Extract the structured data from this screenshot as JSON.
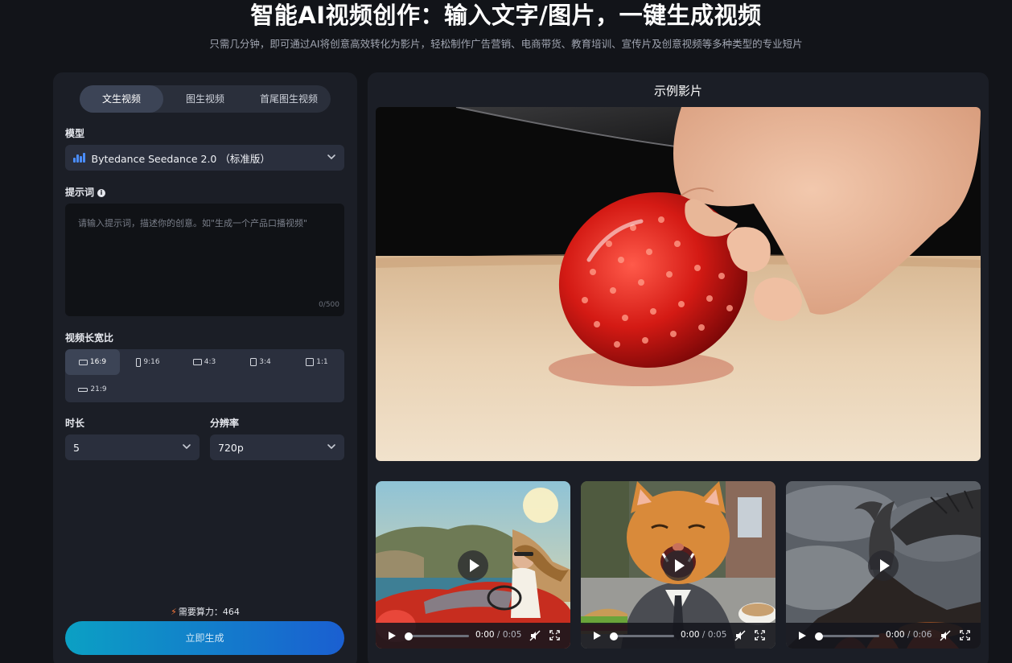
{
  "header": {
    "title": "智能AI视频创作：输入文字/图片，一键生成视频",
    "subtitle": "只需几分钟，即可通过AI将创意高效转化为影片，轻松制作广告营销、电商带货、教育培训、宣传片及创意视频等多种类型的专业短片"
  },
  "mode_tabs": [
    {
      "label": "文生视频",
      "active": true
    },
    {
      "label": "图生视频",
      "active": false
    },
    {
      "label": "首尾图生视频",
      "active": false
    }
  ],
  "model": {
    "label": "模型",
    "selected": "Bytedance Seedance 2.0 （标准版）",
    "icon": "bar-chart-icon"
  },
  "prompt": {
    "label": "提示词",
    "info_icon": "info-icon",
    "placeholder": "请输入提示词，描述你的创意。如\"生成一个产品口播视频\"",
    "value": "",
    "char_count": "0/500"
  },
  "aspect_ratio": {
    "label": "视频长宽比",
    "options": [
      {
        "label": "16:9",
        "active": true
      },
      {
        "label": "9:16",
        "active": false
      },
      {
        "label": "4:3",
        "active": false
      },
      {
        "label": "3:4",
        "active": false
      },
      {
        "label": "1:1",
        "active": false
      },
      {
        "label": "21:9",
        "active": false
      }
    ]
  },
  "duration": {
    "label": "时长",
    "selected": "5"
  },
  "resolution": {
    "label": "分辨率",
    "selected": "720p"
  },
  "cost": {
    "label": "需要算力：",
    "value": "464"
  },
  "generate_button": "立即生成",
  "showcase": {
    "title": "示例影片",
    "thumbnails": [
      {
        "current": "0:00",
        "total": "0:05"
      },
      {
        "current": "0:00",
        "total": "0:05"
      },
      {
        "current": "0:00",
        "total": "0:06"
      }
    ]
  },
  "colors": {
    "background": "#121419",
    "panel": "#1b1e26",
    "accent_start": "#0ba0c4",
    "accent_end": "#1a5fd1",
    "model_icon": "#4a8dff",
    "bolt": "#ff7a3a"
  }
}
